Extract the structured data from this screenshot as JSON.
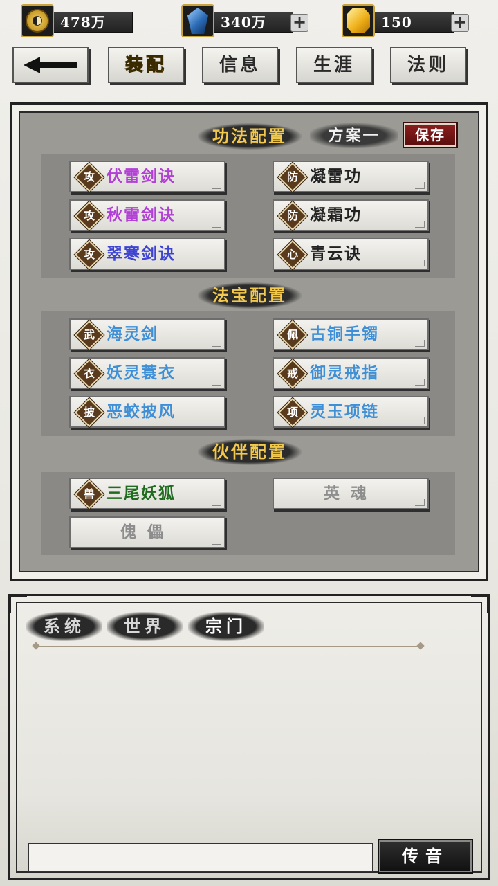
{
  "currencies": {
    "coins": {
      "icon": "coin-icon",
      "value": "478万"
    },
    "crystals": {
      "icon": "spirit-crystal-icon",
      "value": "340万",
      "plus": "+"
    },
    "gold": {
      "icon": "gold-ingot-icon",
      "value": "150",
      "plus": "+"
    }
  },
  "nav": {
    "back_icon": "back-arrow-icon",
    "tabs": [
      "装配",
      "信息",
      "生涯",
      "法则"
    ],
    "active_tab": "装配"
  },
  "loadout": {
    "skills": {
      "title": "功法配置",
      "plan_label": "方案一",
      "save_label": "保存",
      "slots": [
        {
          "badge": "攻",
          "name": "伏雷剑诀",
          "color": "#b23fd6"
        },
        {
          "badge": "防",
          "name": "凝雷功",
          "color": "#222222"
        },
        {
          "badge": "攻",
          "name": "秋雷剑诀",
          "color": "#b23fd6"
        },
        {
          "badge": "防",
          "name": "凝霜功",
          "color": "#222222"
        },
        {
          "badge": "攻",
          "name": "翠寒剑诀",
          "color": "#3d44d2"
        },
        {
          "badge": "心",
          "name": "青云诀",
          "color": "#222222"
        }
      ]
    },
    "treasures": {
      "title": "法宝配置",
      "slots": [
        {
          "badge": "武",
          "name": "海灵剑",
          "color": "#3f8fd6"
        },
        {
          "badge": "佩",
          "name": "古铜手镯",
          "color": "#3f8fd6"
        },
        {
          "badge": "衣",
          "name": "妖灵蓑衣",
          "color": "#3f8fd6"
        },
        {
          "badge": "戒",
          "name": "御灵戒指",
          "color": "#3f8fd6"
        },
        {
          "badge": "披",
          "name": "恶蛟披风",
          "color": "#3f8fd6"
        },
        {
          "badge": "项",
          "name": "灵玉项链",
          "color": "#3f8fd6"
        }
      ]
    },
    "companions": {
      "title": "伙伴配置",
      "slots": [
        {
          "badge": "兽",
          "name": "三尾妖狐",
          "color": "#1f6b1f"
        },
        {
          "empty_label": "英魂"
        },
        {
          "empty_label": "傀儡"
        }
      ]
    }
  },
  "chat": {
    "tabs": [
      "系统",
      "世界",
      "宗门"
    ],
    "active_tab": "宗门",
    "input_value": "",
    "send_label": "传音"
  }
}
